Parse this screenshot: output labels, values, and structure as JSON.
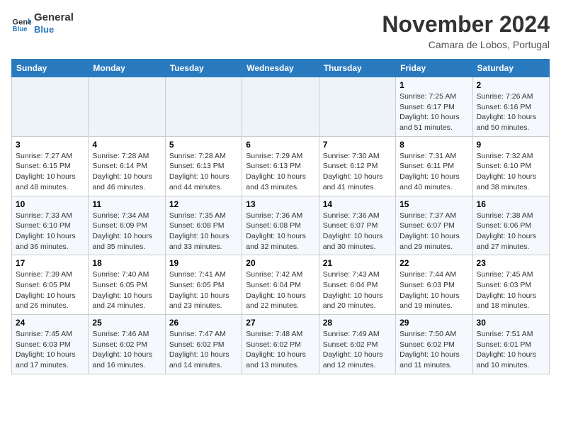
{
  "header": {
    "logo_line1": "General",
    "logo_line2": "Blue",
    "month": "November 2024",
    "location": "Camara de Lobos, Portugal"
  },
  "days_of_week": [
    "Sunday",
    "Monday",
    "Tuesday",
    "Wednesday",
    "Thursday",
    "Friday",
    "Saturday"
  ],
  "weeks": [
    [
      {
        "day": "",
        "info": ""
      },
      {
        "day": "",
        "info": ""
      },
      {
        "day": "",
        "info": ""
      },
      {
        "day": "",
        "info": ""
      },
      {
        "day": "",
        "info": ""
      },
      {
        "day": "1",
        "info": "Sunrise: 7:25 AM\nSunset: 6:17 PM\nDaylight: 10 hours and 51 minutes."
      },
      {
        "day": "2",
        "info": "Sunrise: 7:26 AM\nSunset: 6:16 PM\nDaylight: 10 hours and 50 minutes."
      }
    ],
    [
      {
        "day": "3",
        "info": "Sunrise: 7:27 AM\nSunset: 6:15 PM\nDaylight: 10 hours and 48 minutes."
      },
      {
        "day": "4",
        "info": "Sunrise: 7:28 AM\nSunset: 6:14 PM\nDaylight: 10 hours and 46 minutes."
      },
      {
        "day": "5",
        "info": "Sunrise: 7:28 AM\nSunset: 6:13 PM\nDaylight: 10 hours and 44 minutes."
      },
      {
        "day": "6",
        "info": "Sunrise: 7:29 AM\nSunset: 6:13 PM\nDaylight: 10 hours and 43 minutes."
      },
      {
        "day": "7",
        "info": "Sunrise: 7:30 AM\nSunset: 6:12 PM\nDaylight: 10 hours and 41 minutes."
      },
      {
        "day": "8",
        "info": "Sunrise: 7:31 AM\nSunset: 6:11 PM\nDaylight: 10 hours and 40 minutes."
      },
      {
        "day": "9",
        "info": "Sunrise: 7:32 AM\nSunset: 6:10 PM\nDaylight: 10 hours and 38 minutes."
      }
    ],
    [
      {
        "day": "10",
        "info": "Sunrise: 7:33 AM\nSunset: 6:10 PM\nDaylight: 10 hours and 36 minutes."
      },
      {
        "day": "11",
        "info": "Sunrise: 7:34 AM\nSunset: 6:09 PM\nDaylight: 10 hours and 35 minutes."
      },
      {
        "day": "12",
        "info": "Sunrise: 7:35 AM\nSunset: 6:08 PM\nDaylight: 10 hours and 33 minutes."
      },
      {
        "day": "13",
        "info": "Sunrise: 7:36 AM\nSunset: 6:08 PM\nDaylight: 10 hours and 32 minutes."
      },
      {
        "day": "14",
        "info": "Sunrise: 7:36 AM\nSunset: 6:07 PM\nDaylight: 10 hours and 30 minutes."
      },
      {
        "day": "15",
        "info": "Sunrise: 7:37 AM\nSunset: 6:07 PM\nDaylight: 10 hours and 29 minutes."
      },
      {
        "day": "16",
        "info": "Sunrise: 7:38 AM\nSunset: 6:06 PM\nDaylight: 10 hours and 27 minutes."
      }
    ],
    [
      {
        "day": "17",
        "info": "Sunrise: 7:39 AM\nSunset: 6:05 PM\nDaylight: 10 hours and 26 minutes."
      },
      {
        "day": "18",
        "info": "Sunrise: 7:40 AM\nSunset: 6:05 PM\nDaylight: 10 hours and 24 minutes."
      },
      {
        "day": "19",
        "info": "Sunrise: 7:41 AM\nSunset: 6:05 PM\nDaylight: 10 hours and 23 minutes."
      },
      {
        "day": "20",
        "info": "Sunrise: 7:42 AM\nSunset: 6:04 PM\nDaylight: 10 hours and 22 minutes."
      },
      {
        "day": "21",
        "info": "Sunrise: 7:43 AM\nSunset: 6:04 PM\nDaylight: 10 hours and 20 minutes."
      },
      {
        "day": "22",
        "info": "Sunrise: 7:44 AM\nSunset: 6:03 PM\nDaylight: 10 hours and 19 minutes."
      },
      {
        "day": "23",
        "info": "Sunrise: 7:45 AM\nSunset: 6:03 PM\nDaylight: 10 hours and 18 minutes."
      }
    ],
    [
      {
        "day": "24",
        "info": "Sunrise: 7:45 AM\nSunset: 6:03 PM\nDaylight: 10 hours and 17 minutes."
      },
      {
        "day": "25",
        "info": "Sunrise: 7:46 AM\nSunset: 6:02 PM\nDaylight: 10 hours and 16 minutes."
      },
      {
        "day": "26",
        "info": "Sunrise: 7:47 AM\nSunset: 6:02 PM\nDaylight: 10 hours and 14 minutes."
      },
      {
        "day": "27",
        "info": "Sunrise: 7:48 AM\nSunset: 6:02 PM\nDaylight: 10 hours and 13 minutes."
      },
      {
        "day": "28",
        "info": "Sunrise: 7:49 AM\nSunset: 6:02 PM\nDaylight: 10 hours and 12 minutes."
      },
      {
        "day": "29",
        "info": "Sunrise: 7:50 AM\nSunset: 6:02 PM\nDaylight: 10 hours and 11 minutes."
      },
      {
        "day": "30",
        "info": "Sunrise: 7:51 AM\nSunset: 6:01 PM\nDaylight: 10 hours and 10 minutes."
      }
    ]
  ]
}
